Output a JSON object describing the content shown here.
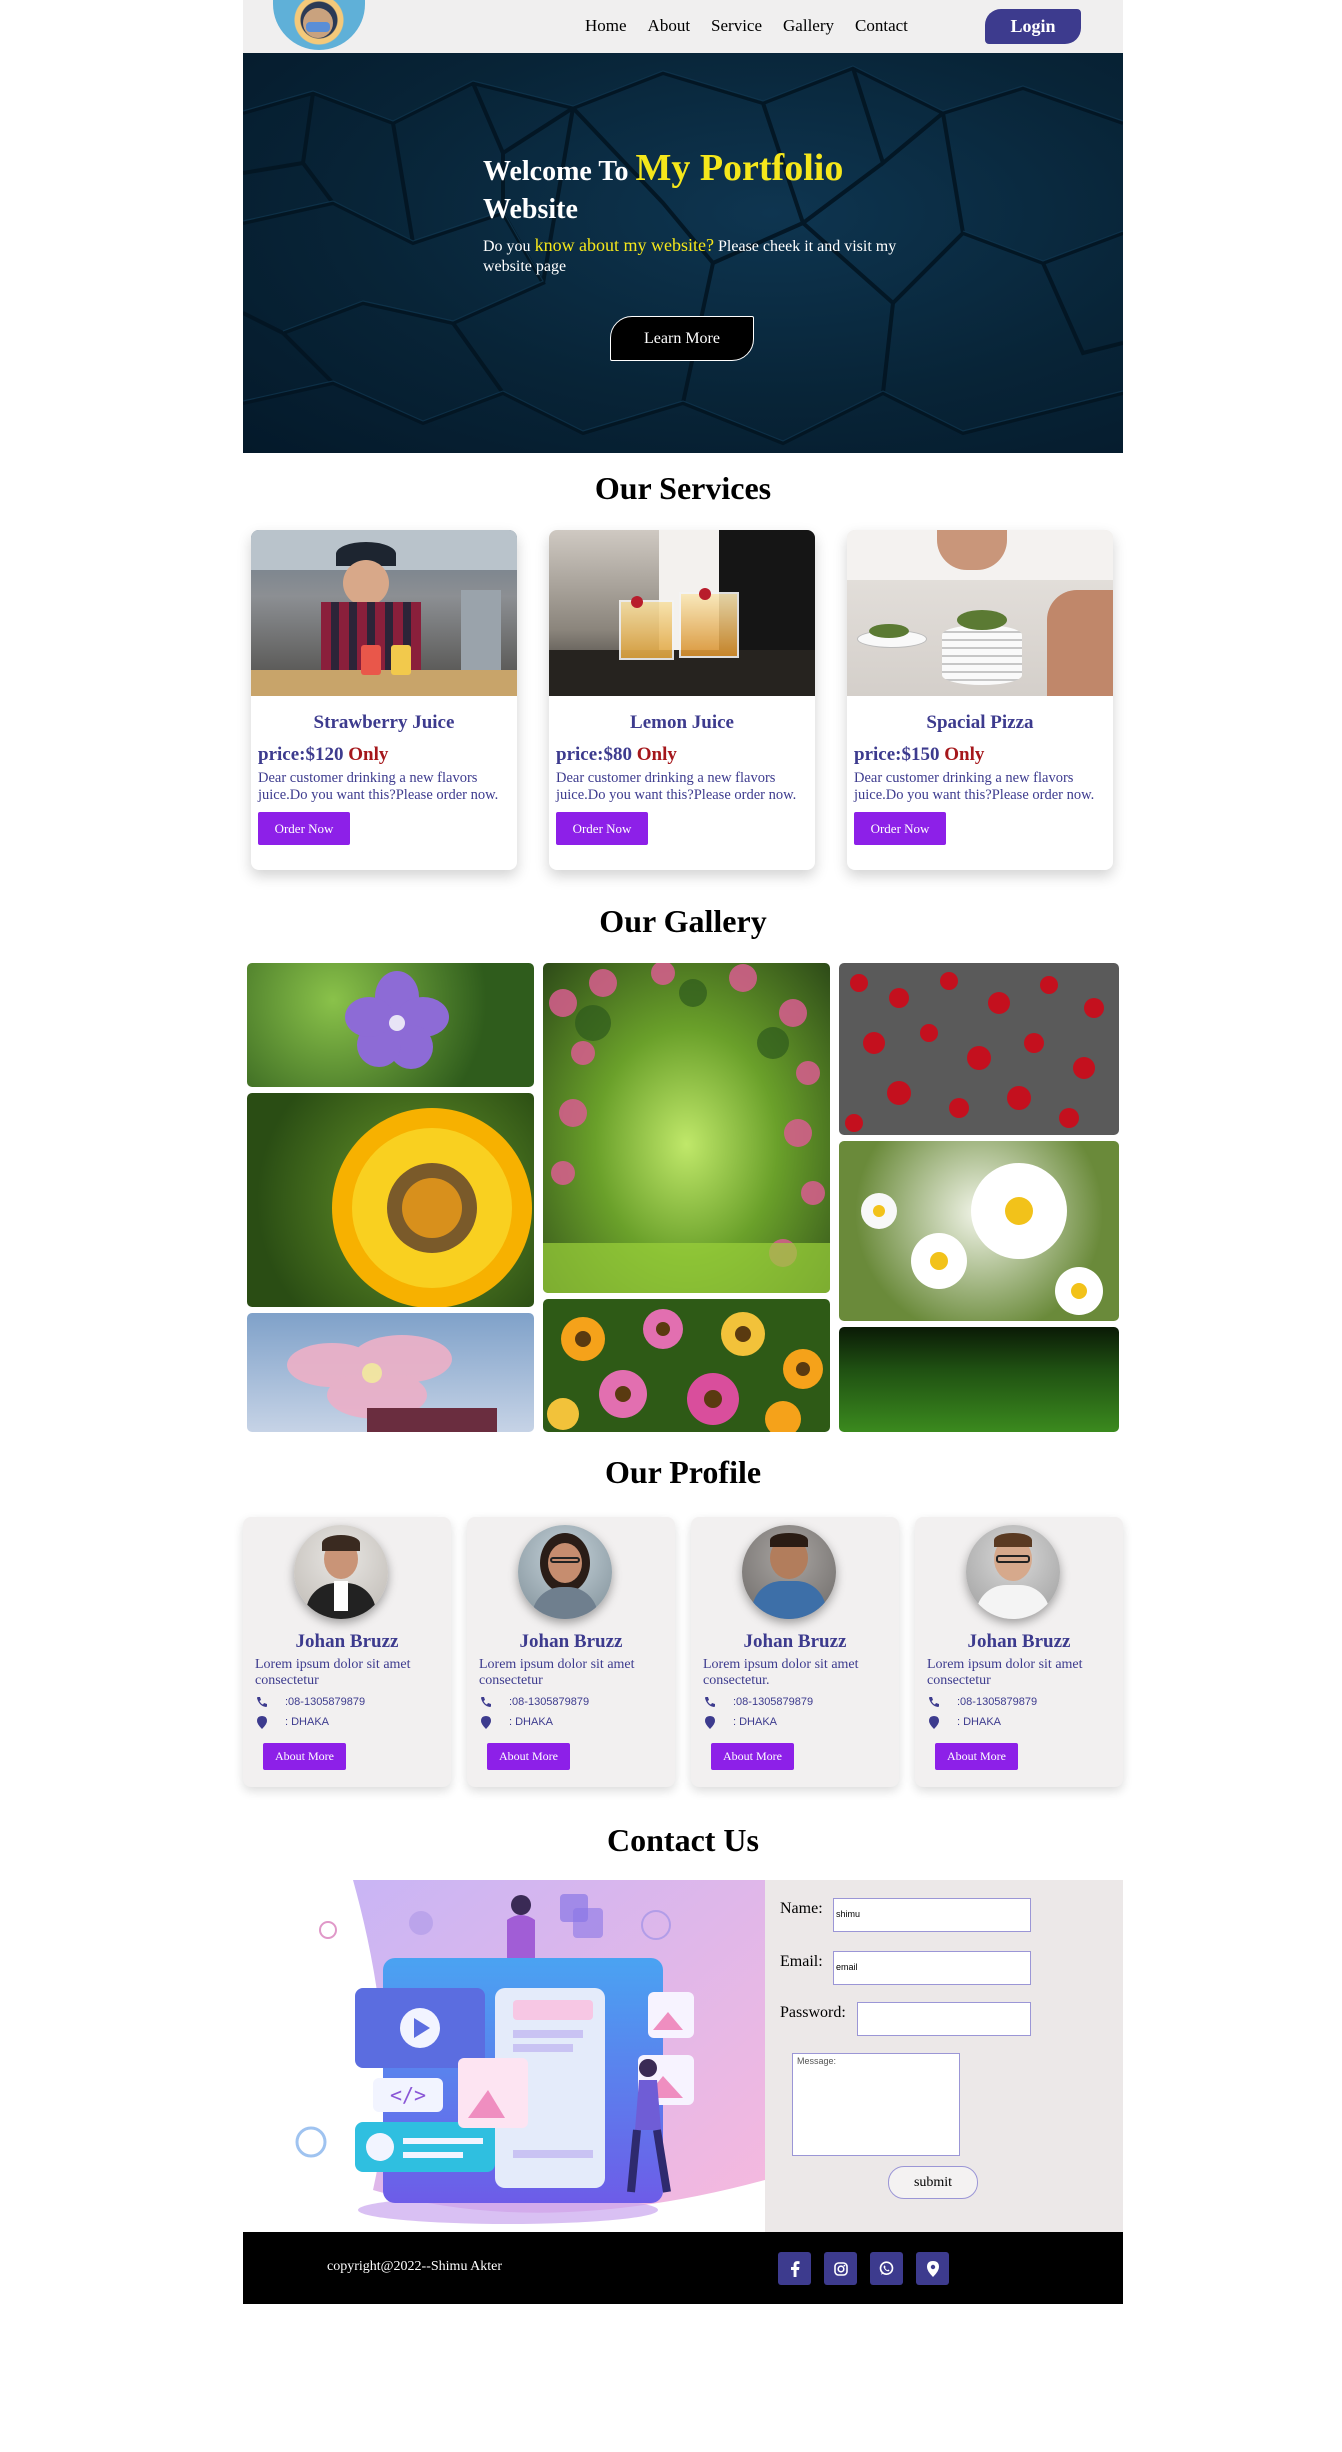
{
  "nav": {
    "items": [
      "Home",
      "About",
      "Service",
      "Gallery",
      "Contact"
    ],
    "login": "Login"
  },
  "hero": {
    "title_start": "Welcome To ",
    "title_highlight": "My Portfolio",
    "title_end": "Website",
    "sub_start": "Do you ",
    "sub_highlight": "know about my website?",
    "sub_end": " Please cheek it and visit my website page",
    "button": "Learn More"
  },
  "services": {
    "title": "Our Services",
    "items": [
      {
        "name": "Strawberry Juice",
        "price": "price:$120",
        "only": "Only",
        "desc": "Dear customer drinking a new flavors juice.Do you want this?Please order now.",
        "button": "Order Now"
      },
      {
        "name": "Lemon Juice",
        "price": "price:$80",
        "only": "Only",
        "desc": "Dear customer drinking a new flavors juice.Do you want this?Please order now.",
        "button": "Order Now"
      },
      {
        "name": "Spacial Pizza",
        "price": "price:$150",
        "only": "Only",
        "desc": "Dear customer drinking a new flavors juice.Do you want this?Please order now.",
        "button": "Order Now"
      }
    ]
  },
  "gallery": {
    "title": "Our Gallery"
  },
  "profile": {
    "title": "Our Profile",
    "items": [
      {
        "name": "Johan Bruzz",
        "desc": "Lorem ipsum dolor sit amet consectetur",
        "phone": ":08-1305879879",
        "location": ": DHAKA",
        "button": "About More"
      },
      {
        "name": "Johan Bruzz",
        "desc": "Lorem ipsum dolor sit amet consectetur",
        "phone": ":08-1305879879",
        "location": ": DHAKA",
        "button": "About More"
      },
      {
        "name": "Johan Bruzz",
        "desc": "Lorem ipsum dolor sit amet consectetur.",
        "phone": ":08-1305879879",
        "location": ": DHAKA",
        "button": "About More"
      },
      {
        "name": "Johan Bruzz",
        "desc": "Lorem ipsum dolor sit amet consectetur",
        "phone": ":08-1305879879",
        "location": ": DHAKA",
        "button": "About More"
      }
    ]
  },
  "contact": {
    "title": "Contact Us",
    "name_label": "Name:",
    "name_value": "shimu",
    "email_label": "Email:",
    "email_value": "email",
    "password_label": "Password:",
    "message_placeholder": "Message:",
    "submit": "submit"
  },
  "footer": {
    "copyright": "copyright@2022--Shimu Akter",
    "social_icons": [
      "facebook-icon",
      "instagram-icon",
      "whatsapp-icon",
      "location-icon"
    ]
  },
  "colors": {
    "brand": "#3d3b8e",
    "accent_button": "#8d20e8",
    "highlight_yellow": "#f5e71b",
    "price_red": "#a5171b"
  }
}
